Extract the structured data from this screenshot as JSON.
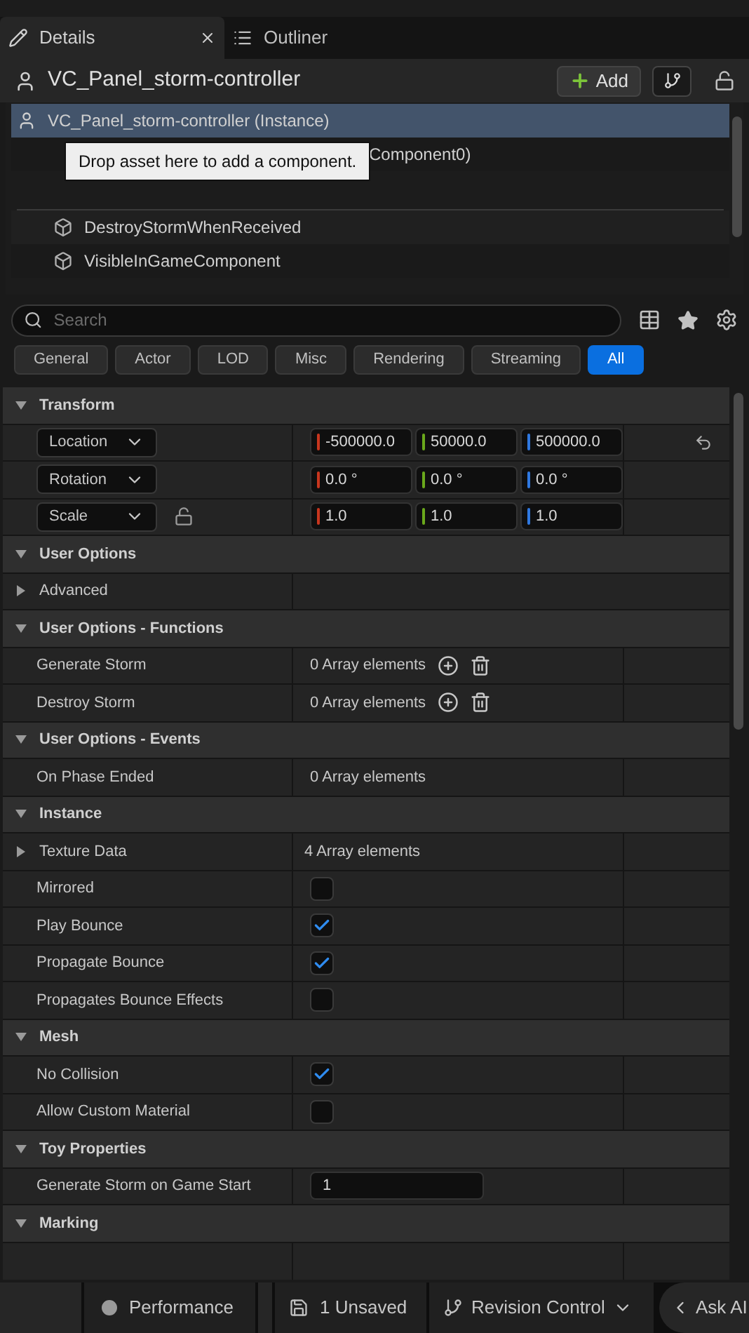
{
  "tabs": [
    {
      "label": "Details",
      "selected": true,
      "closable": true
    },
    {
      "label": "Outliner",
      "selected": false,
      "closable": false
    }
  ],
  "header": {
    "title": "VC_Panel_storm-controller",
    "add_label": "Add"
  },
  "tree": {
    "rows": [
      {
        "label": "VC_Panel_storm-controller (Instance)",
        "selected": true,
        "kind": "root"
      },
      {
        "label": "Component0)",
        "selected": false,
        "kind": "mesh"
      },
      {
        "label": "DestroyStormWhenReceived",
        "selected": false,
        "kind": "component"
      },
      {
        "label": "VisibleInGameComponent",
        "selected": false,
        "kind": "component"
      }
    ],
    "tooltip": "Drop asset here to add a component."
  },
  "search": {
    "placeholder": "Search"
  },
  "filters": [
    {
      "label": "General",
      "selected": false
    },
    {
      "label": "Actor",
      "selected": false
    },
    {
      "label": "LOD",
      "selected": false
    },
    {
      "label": "Misc",
      "selected": false
    },
    {
      "label": "Rendering",
      "selected": false
    },
    {
      "label": "Streaming",
      "selected": false
    },
    {
      "label": "All",
      "selected": true
    }
  ],
  "properties": [
    {
      "kind": "category",
      "label": "Transform"
    },
    {
      "kind": "vector",
      "label": "Location",
      "values": [
        "-500000.0",
        "50000.0",
        "500000.0"
      ],
      "resettable": true,
      "lock": false
    },
    {
      "kind": "vector",
      "label": "Rotation",
      "values": [
        "0.0 °",
        "0.0 °",
        "0.0 °"
      ],
      "resettable": false,
      "lock": false
    },
    {
      "kind": "vector",
      "label": "Scale",
      "values": [
        "1.0",
        "1.0",
        "1.0"
      ],
      "resettable": false,
      "lock": true
    },
    {
      "kind": "category",
      "label": "User Options"
    },
    {
      "kind": "group",
      "label": "Advanced"
    },
    {
      "kind": "category",
      "label": "User Options - Functions"
    },
    {
      "kind": "array",
      "label": "Generate Storm",
      "value": "0 Array elements",
      "buttons": true
    },
    {
      "kind": "array",
      "label": "Destroy Storm",
      "value": "0 Array elements",
      "buttons": true
    },
    {
      "kind": "category",
      "label": "User Options - Events"
    },
    {
      "kind": "array",
      "label": "On Phase Ended",
      "value": "0 Array elements",
      "buttons": false
    },
    {
      "kind": "category",
      "label": "Instance"
    },
    {
      "kind": "group",
      "label": "Texture Data",
      "value": "4 Array elements"
    },
    {
      "kind": "checkbox",
      "label": "Mirrored",
      "checked": false
    },
    {
      "kind": "checkbox",
      "label": "Play Bounce",
      "checked": true
    },
    {
      "kind": "checkbox",
      "label": "Propagate Bounce",
      "checked": true
    },
    {
      "kind": "checkbox",
      "label": "Propagates Bounce Effects",
      "checked": false
    },
    {
      "kind": "category",
      "label": "Mesh"
    },
    {
      "kind": "checkbox",
      "label": "No Collision",
      "checked": true
    },
    {
      "kind": "checkbox",
      "label": "Allow Custom Material",
      "checked": false
    },
    {
      "kind": "category",
      "label": "Toy Properties"
    },
    {
      "kind": "text",
      "label": "Generate Storm on Game Start",
      "value": "1"
    },
    {
      "kind": "category",
      "label": "Marking"
    }
  ],
  "status_bar": {
    "performance": "Performance",
    "unsaved": "1 Unsaved",
    "revision": "Revision Control",
    "ask": "Ask AI"
  }
}
